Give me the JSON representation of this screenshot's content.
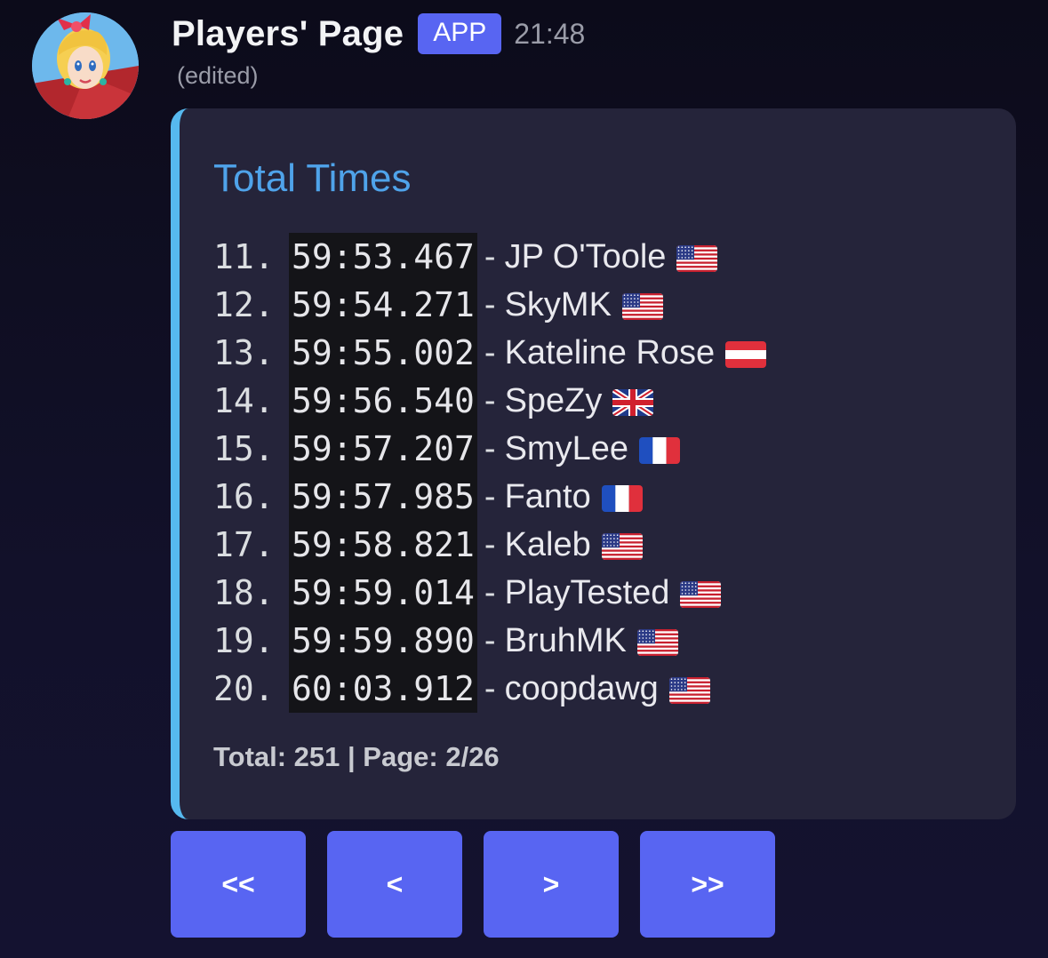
{
  "message": {
    "username": "Players' Page",
    "badge": "APP",
    "timestamp": "21:48",
    "edited": "(edited)"
  },
  "embed": {
    "accent_color": "#56b9ef",
    "title": "Total Times",
    "title_color": "#4fa3ea",
    "separator": "-",
    "rows": [
      {
        "rank": "11.",
        "time": "59:53.467",
        "player": "JP O'Toole",
        "flag": "us-flag-icon"
      },
      {
        "rank": "12.",
        "time": "59:54.271",
        "player": "SkyMK",
        "flag": "us-flag-icon"
      },
      {
        "rank": "13.",
        "time": "59:55.002",
        "player": "Kateline Rose",
        "flag": "austria-flag-icon"
      },
      {
        "rank": "14.",
        "time": "59:56.540",
        "player": "SpeZy",
        "flag": "uk-flag-icon"
      },
      {
        "rank": "15.",
        "time": "59:57.207",
        "player": "SmyLee",
        "flag": "france-flag-icon"
      },
      {
        "rank": "16.",
        "time": "59:57.985",
        "player": "Fanto",
        "flag": "france-flag-icon"
      },
      {
        "rank": "17.",
        "time": "59:58.821",
        "player": "Kaleb",
        "flag": "us-flag-icon"
      },
      {
        "rank": "18.",
        "time": "59:59.014",
        "player": "PlayTested",
        "flag": "us-flag-icon"
      },
      {
        "rank": "19.",
        "time": "59:59.890",
        "player": "BruhMK",
        "flag": "us-flag-icon"
      },
      {
        "rank": "20.",
        "time": "60:03.912",
        "player": "coopdawg",
        "flag": "us-flag-icon"
      }
    ],
    "footer": "Total: 251 | Page: 2/26"
  },
  "buttons": [
    {
      "label": "<<",
      "name": "first-page-button"
    },
    {
      "label": "<",
      "name": "previous-page-button"
    },
    {
      "label": ">",
      "name": "next-page-button"
    },
    {
      "label": ">>",
      "name": "last-page-button"
    }
  ],
  "colors": {
    "brand": "#5865f2",
    "background": "#0f0e1f",
    "embed_background": "#25243a"
  }
}
